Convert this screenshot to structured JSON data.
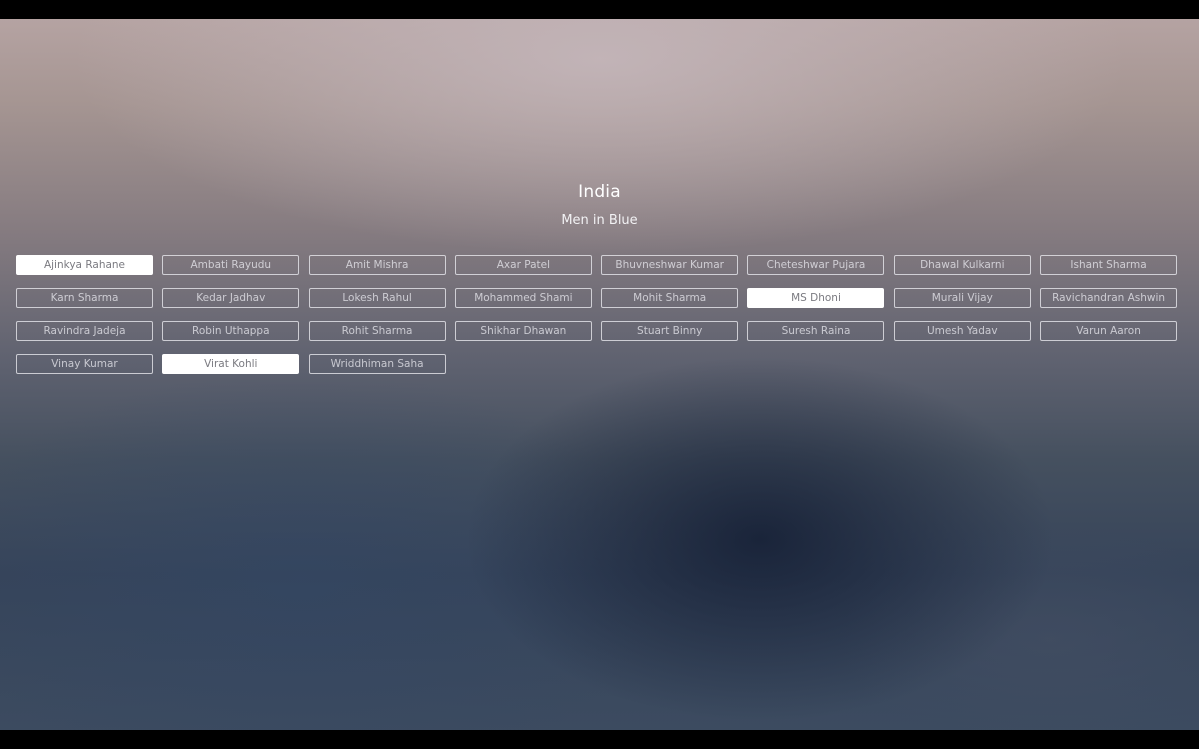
{
  "team": {
    "name": "India",
    "nickname": "Men in Blue"
  },
  "players": [
    {
      "name": "Ajinkya Rahane",
      "selected": true
    },
    {
      "name": "Ambati Rayudu",
      "selected": false
    },
    {
      "name": "Amit Mishra",
      "selected": false
    },
    {
      "name": "Axar Patel",
      "selected": false
    },
    {
      "name": "Bhuvneshwar Kumar",
      "selected": false
    },
    {
      "name": "Cheteshwar Pujara",
      "selected": false
    },
    {
      "name": "Dhawal Kulkarni",
      "selected": false
    },
    {
      "name": "Ishant Sharma",
      "selected": false
    },
    {
      "name": "Karn Sharma",
      "selected": false
    },
    {
      "name": "Kedar Jadhav",
      "selected": false
    },
    {
      "name": "Lokesh Rahul",
      "selected": false
    },
    {
      "name": "Mohammed Shami",
      "selected": false
    },
    {
      "name": "Mohit Sharma",
      "selected": false
    },
    {
      "name": "MS Dhoni",
      "selected": true
    },
    {
      "name": "Murali Vijay",
      "selected": false
    },
    {
      "name": "Ravichandran Ashwin",
      "selected": false
    },
    {
      "name": "Ravindra Jadeja",
      "selected": false
    },
    {
      "name": "Robin Uthappa",
      "selected": false
    },
    {
      "name": "Rohit Sharma",
      "selected": false
    },
    {
      "name": "Shikhar Dhawan",
      "selected": false
    },
    {
      "name": "Stuart Binny",
      "selected": false
    },
    {
      "name": "Suresh Raina",
      "selected": false
    },
    {
      "name": "Umesh Yadav",
      "selected": false
    },
    {
      "name": "Varun Aaron",
      "selected": false
    },
    {
      "name": "Vinay Kumar",
      "selected": false
    },
    {
      "name": "Virat Kohli",
      "selected": true
    },
    {
      "name": "Wriddhiman Saha",
      "selected": false
    }
  ]
}
